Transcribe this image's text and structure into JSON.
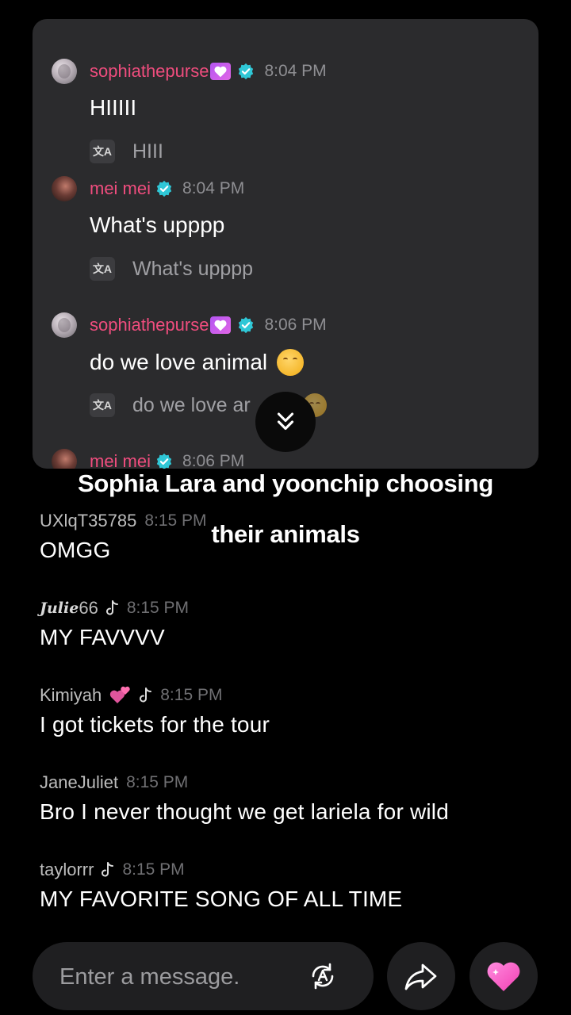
{
  "pinned": {
    "messages": [
      {
        "user": "sophiathepurse",
        "time": "8:04 PM",
        "text": "HIIIII",
        "translation": "HIII",
        "heart": true,
        "emoji": false
      },
      {
        "user": "mei mei",
        "time": "8:04 PM",
        "text": "What's upppp",
        "translation": "What's upppp",
        "heart": false,
        "emoji": false
      },
      {
        "user": "sophiathepurse",
        "time": "8:06 PM",
        "text": "do we love animal",
        "translation": "do we love ar",
        "heart": true,
        "emoji": true
      },
      {
        "user": "mei mei",
        "time": "8:06 PM"
      }
    ],
    "translate_icon_text": "文A"
  },
  "caption": {
    "line1": "Sophia Lara and yoonchip choosing",
    "line2": "their animals"
  },
  "chat": [
    {
      "user": "UXlqT35785",
      "time": "8:15 PM",
      "text": "OMGG"
    },
    {
      "user_script": "Julie",
      "user": "66",
      "time": "8:15 PM",
      "text": "MY FAVVVV"
    },
    {
      "user": "Kimiyah",
      "time": "8:15 PM",
      "text": "I got tickets for the tour"
    },
    {
      "user": "JaneJuliet",
      "time": "8:15 PM",
      "text": "Bro I never thought we get lariela for wild"
    },
    {
      "user": "taylorrr",
      "time": "8:15 PM",
      "text": "MY FAVORITE SONG OF ALL TIME"
    }
  ],
  "input": {
    "placeholder": "Enter a message."
  },
  "colors": {
    "username": "#f04d7e",
    "verified": "#2fc7d6",
    "heart": "#ff5fc8",
    "panel": "#2b2b2d"
  },
  "icons": [
    "translate-icon",
    "verified-badge-icon",
    "heart-badge-icon",
    "chevron-double-down-icon",
    "music-note-icon",
    "share-icon",
    "heart-icon"
  ]
}
